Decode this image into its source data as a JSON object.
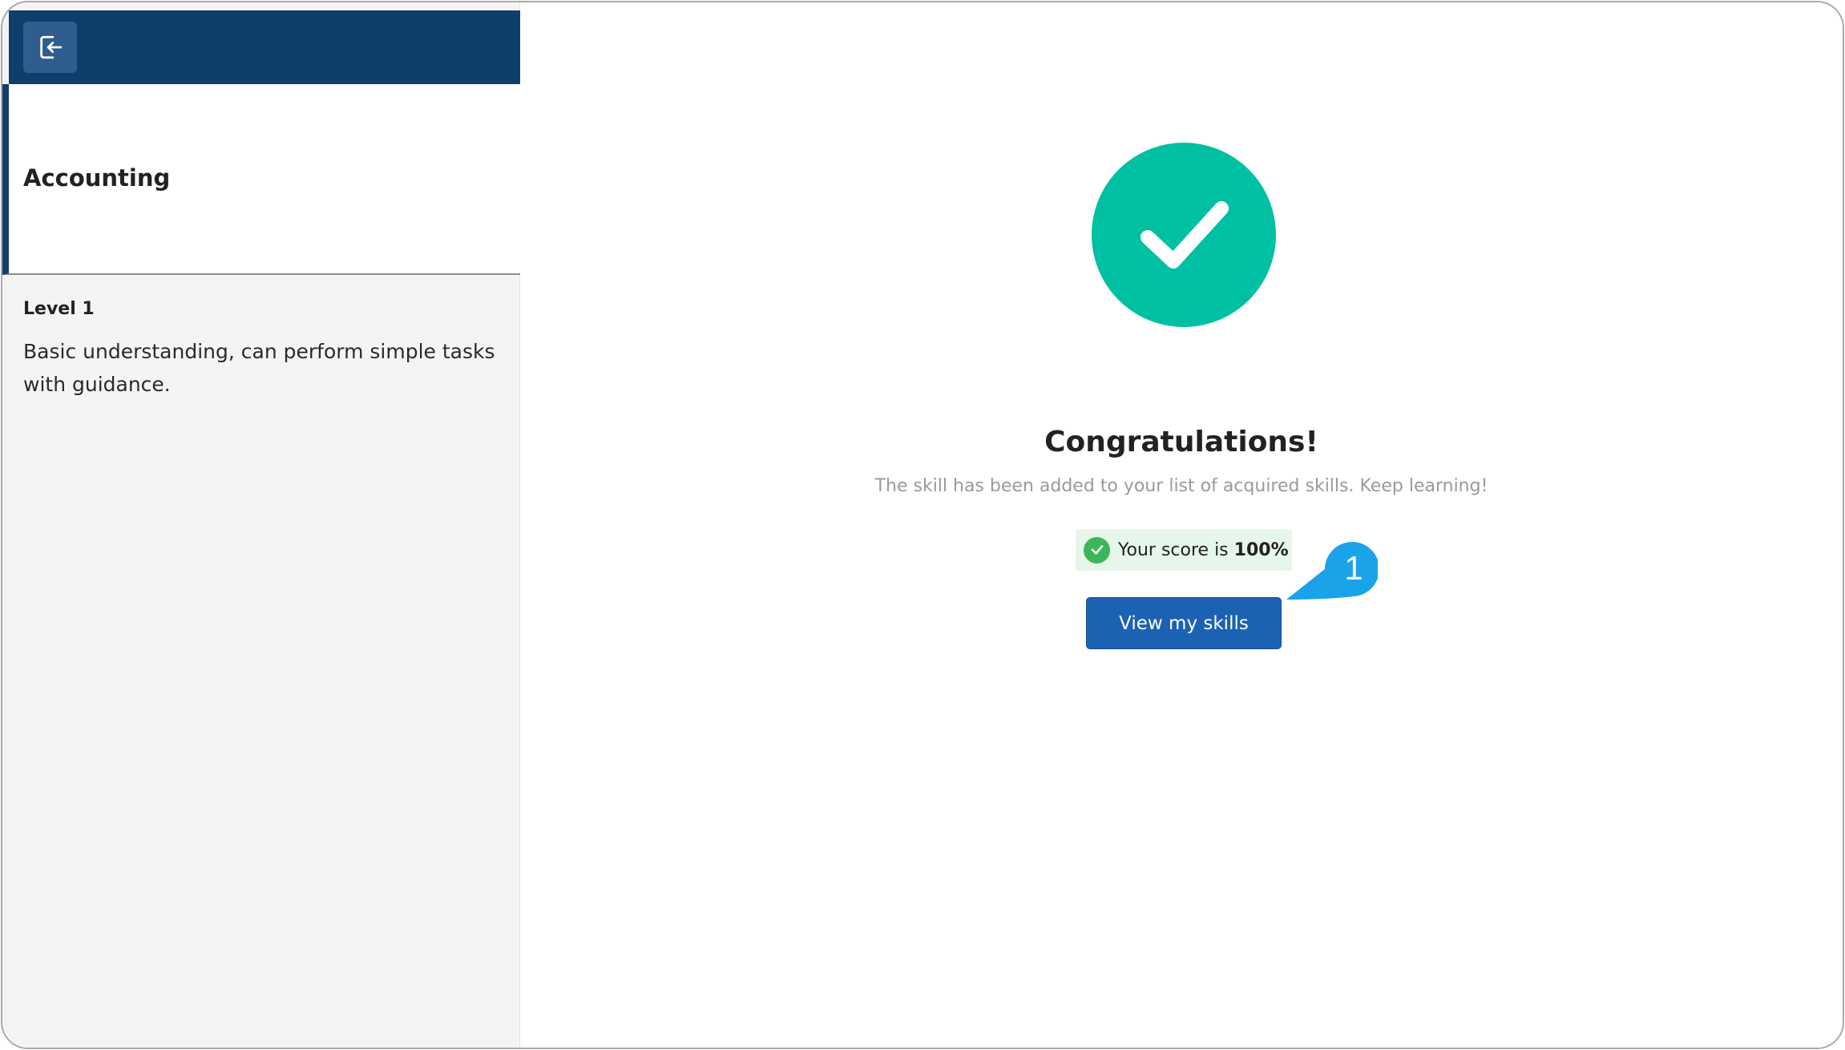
{
  "sidebar": {
    "skill_title": "Accounting",
    "level_label": "Level 1",
    "level_description": "Basic understanding, can perform simple tasks with guidance.",
    "exit_icon": "exit-door-icon"
  },
  "main": {
    "success_icon": "checkmark-icon",
    "headline": "Congratulations!",
    "subtext": "The skill has been added to your list of acquired skills. Keep learning!",
    "score_prefix": "Your score is",
    "score_value": "100%",
    "view_skills_label": "View my skills",
    "step_marker": "1"
  },
  "colors": {
    "sidebar_header": "#103e6b",
    "success": "#00c0a3",
    "primary_button": "#1b62b2",
    "score_badge_bg": "#e6f6ea",
    "step_marker": "#1aa3e8"
  }
}
